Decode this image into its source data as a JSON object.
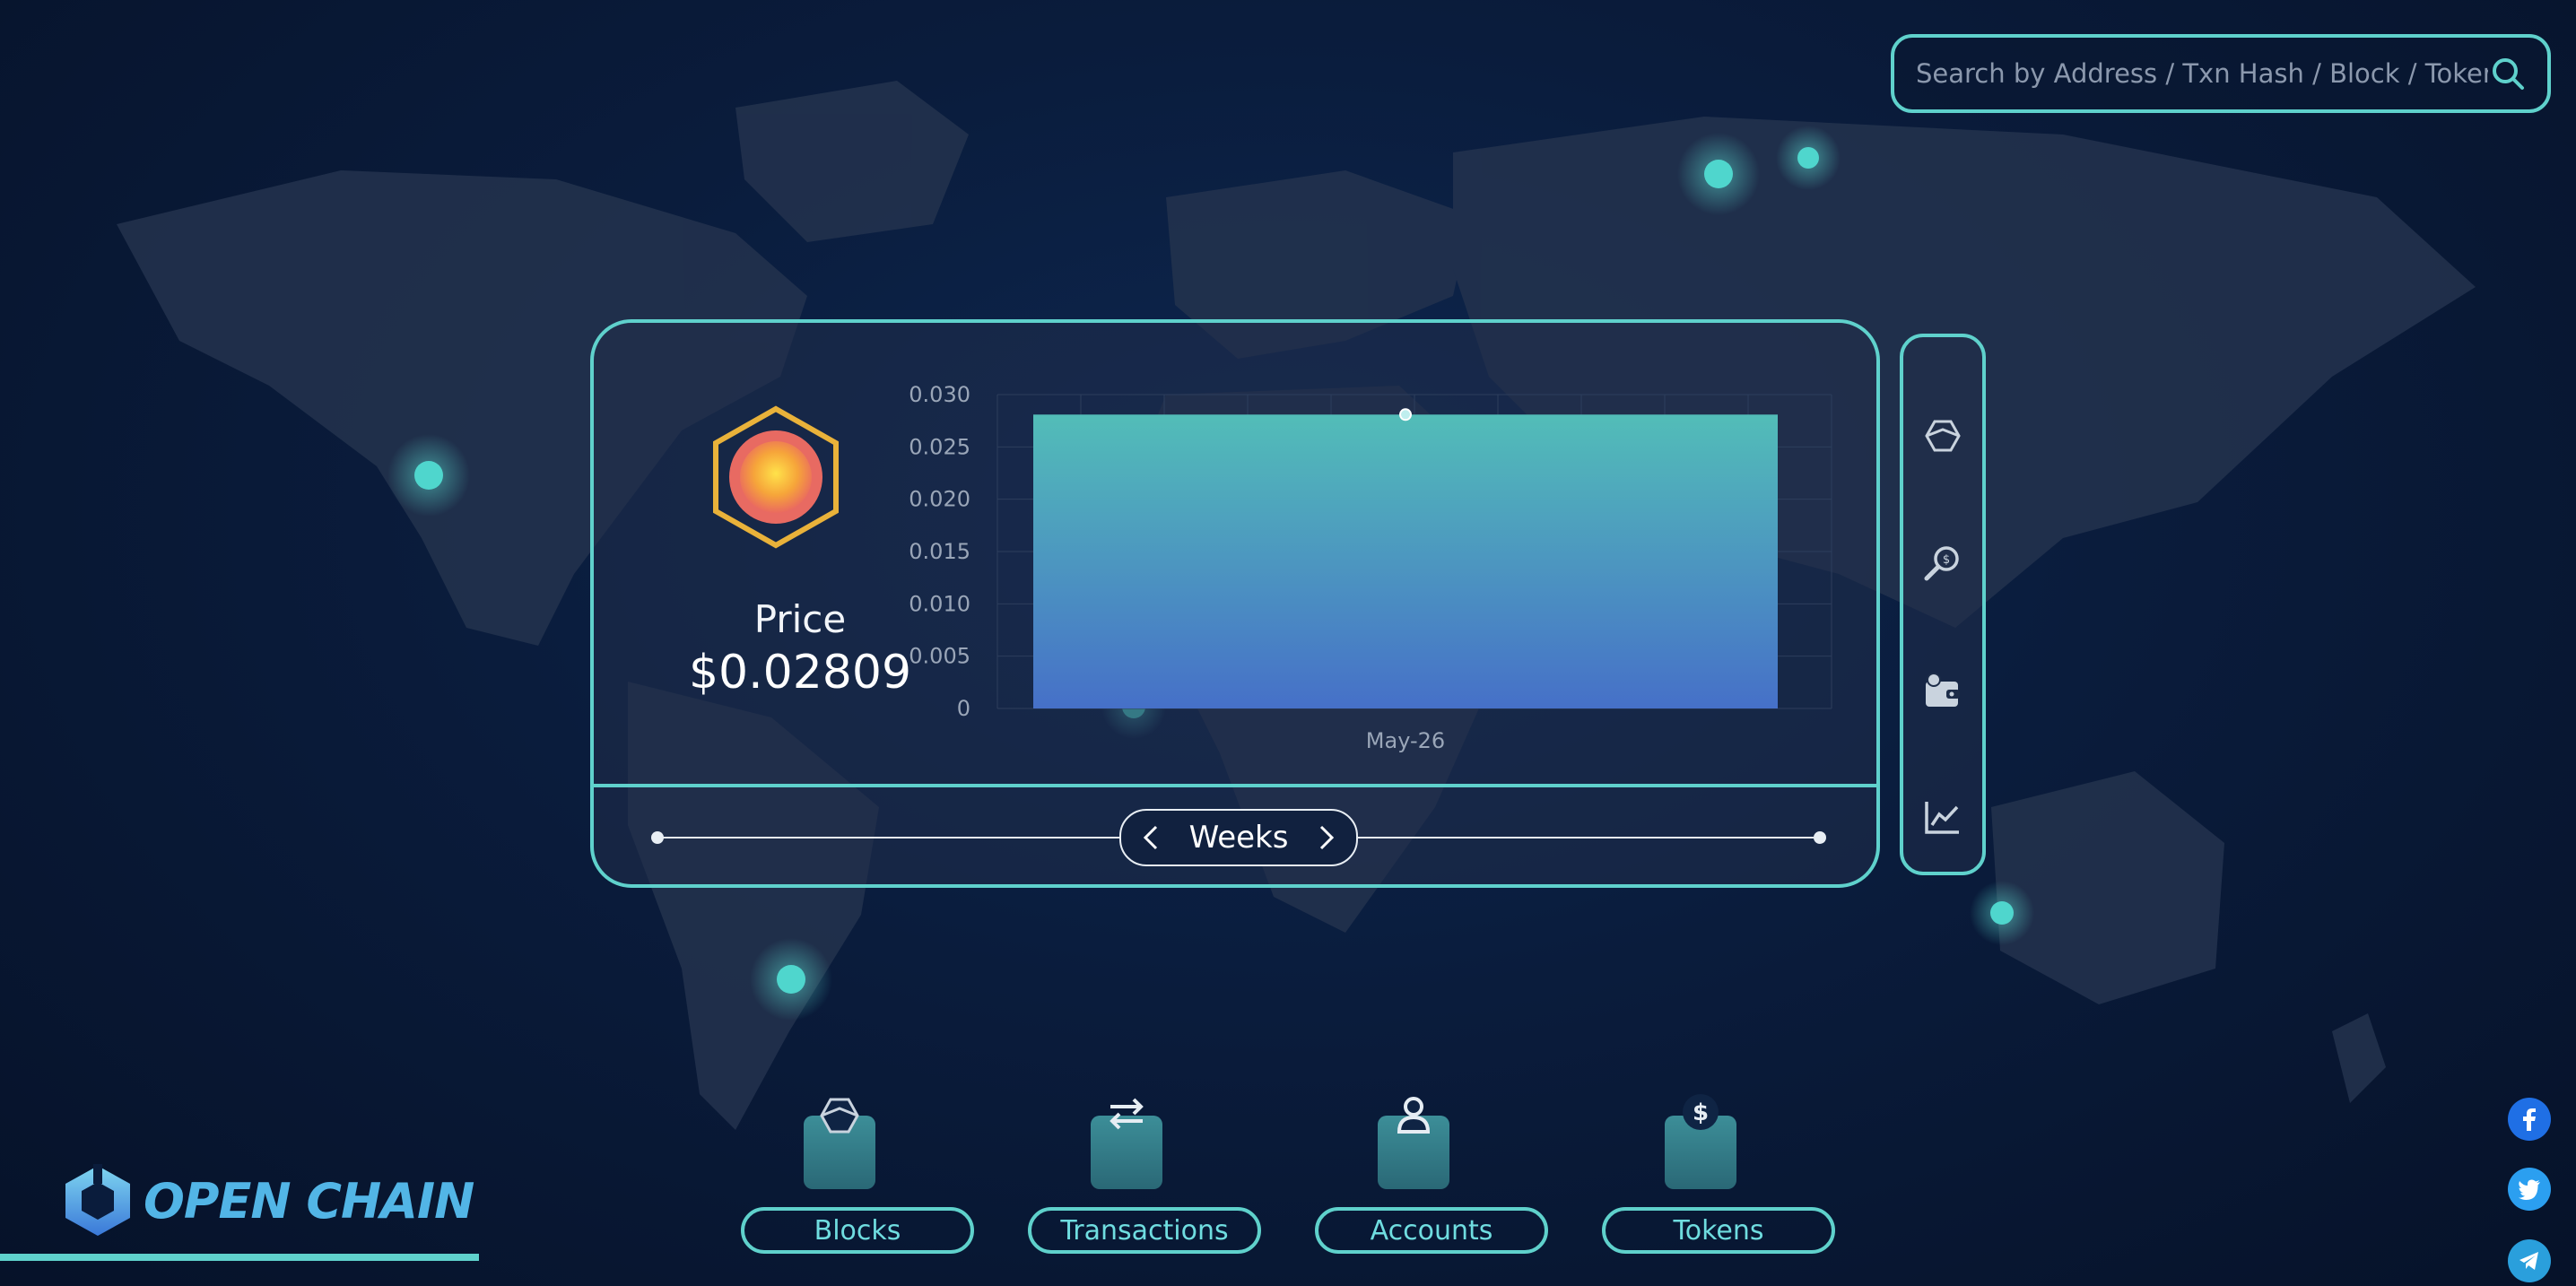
{
  "search": {
    "placeholder": "Search by Address / Txn Hash / Block / Token"
  },
  "price": {
    "label": "Price",
    "value": "$0.02809"
  },
  "chart_data": {
    "type": "area",
    "x": [
      "May-26"
    ],
    "series": [
      {
        "values": [
          0.02809
        ]
      }
    ],
    "yticks": [
      "0",
      "0.005",
      "0.010",
      "0.015",
      "0.020",
      "0.025",
      "0.030"
    ],
    "ylim": [
      0,
      0.03
    ],
    "xlabel": "",
    "ylabel": "",
    "title": "",
    "grid": true
  },
  "range": {
    "label": "Weeks"
  },
  "side_menu": [
    {
      "icon": "cube-icon"
    },
    {
      "icon": "magnifier-coin-icon"
    },
    {
      "icon": "wallet-icon"
    },
    {
      "icon": "line-chart-icon"
    }
  ],
  "nav": [
    {
      "label": "Blocks",
      "icon": "cube-icon"
    },
    {
      "label": "Transactions",
      "icon": "transfer-icon"
    },
    {
      "label": "Accounts",
      "icon": "user-icon"
    },
    {
      "label": "Tokens",
      "icon": "dollar-coin-icon"
    }
  ],
  "brand": {
    "name": "OPEN CHAIN"
  },
  "socials": [
    "facebook-icon",
    "twitter-icon",
    "telegram-icon"
  ],
  "colors": {
    "accent": "#5fd1cc",
    "background": "#0a1c3c",
    "bar_top": "#52bdb8",
    "bar_bottom": "#4670c8"
  }
}
